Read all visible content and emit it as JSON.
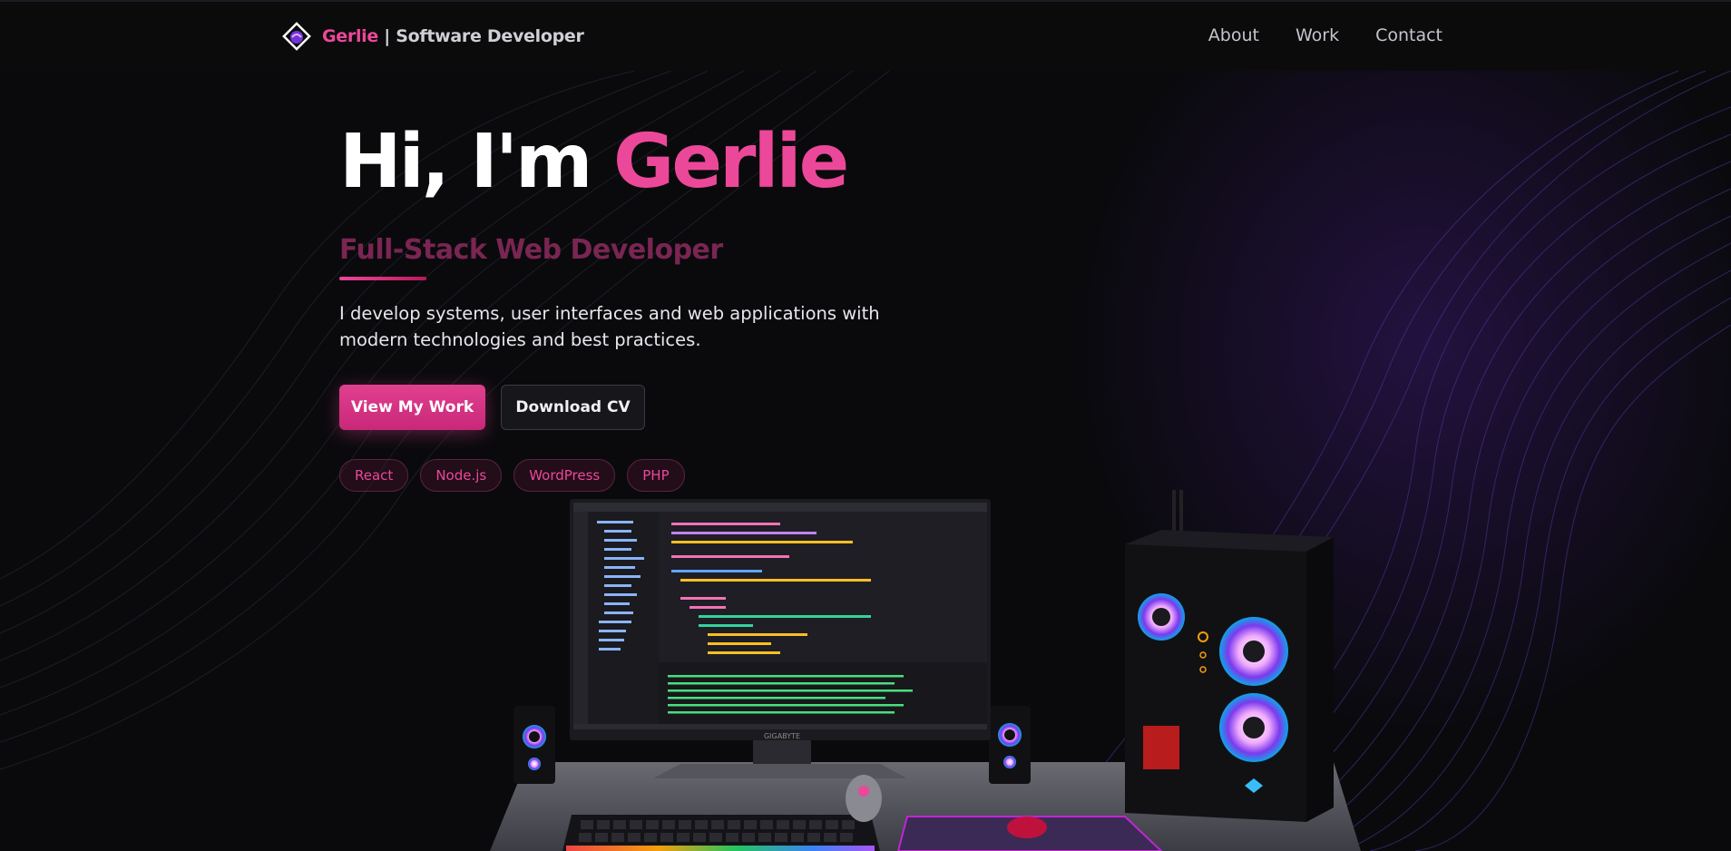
{
  "nav": {
    "brand_name": "Gerlie",
    "brand_sep": " | ",
    "brand_role": "Software Developer",
    "links": [
      {
        "label": "About"
      },
      {
        "label": "Work"
      },
      {
        "label": "Contact"
      }
    ]
  },
  "hero": {
    "title_prefix": "Hi, I'm ",
    "title_name": "Gerlie",
    "subtitle": "Full-Stack Web Developer",
    "description": "I develop systems, user interfaces and web applications with modern technologies and best practices.",
    "primary_button": "View My Work",
    "secondary_button": "Download CV",
    "tags": [
      "React",
      "Node.js",
      "WordPress",
      "PHP"
    ]
  },
  "scene": {
    "monitor_brand": "GIGABYTE"
  },
  "colors": {
    "accent": "#ec4899",
    "background": "#0a0a0d",
    "navbar": "#0b0b0c"
  }
}
